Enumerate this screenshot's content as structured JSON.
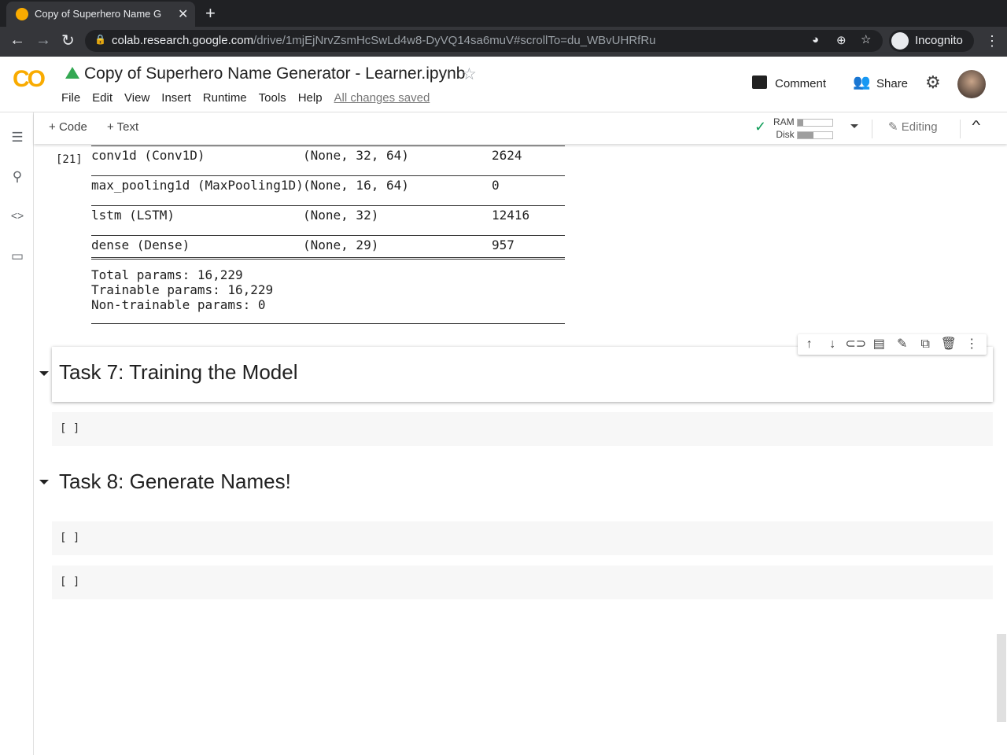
{
  "browser": {
    "tab_title": "Copy of Superhero Name G",
    "url_host": "colab.research.google.com",
    "url_path": "/drive/1mjEjNrvZsmHcSwLd4w8-DyVQ14sa6muV#scrollTo=du_WBvUHRfRu",
    "profile": "Incognito"
  },
  "header": {
    "title": "Copy of Superhero Name Generator - Learner.ipynb",
    "menu": [
      "File",
      "Edit",
      "View",
      "Insert",
      "Runtime",
      "Tools",
      "Help"
    ],
    "save_status": "All changes saved",
    "comment": "Comment",
    "share": "Share"
  },
  "toolbar": {
    "add_code": "Code",
    "add_text": "Text",
    "ram": "RAM",
    "disk": "Disk",
    "ram_usage": 0.15,
    "disk_usage": 0.45,
    "editing": "Editing"
  },
  "output": {
    "exec_count": "[21]",
    "layers": [
      {
        "name": "conv1d (Conv1D)",
        "shape": "(None, 32, 64)",
        "params": "2624"
      },
      {
        "name": "max_pooling1d (MaxPooling1D)",
        "shape": "(None, 16, 64)",
        "params": "0"
      },
      {
        "name": "lstm (LSTM)",
        "shape": "(None, 32)",
        "params": "12416"
      },
      {
        "name": "dense (Dense)",
        "shape": "(None, 29)",
        "params": "957"
      }
    ],
    "total": "Total params: 16,229",
    "trainable": "Trainable params: 16,229",
    "non_trainable": "Non-trainable params: 0"
  },
  "sections": [
    {
      "title": "Task 7: Training the Model"
    },
    {
      "title": "Task 8: Generate Names!"
    }
  ],
  "empty_cell": "[ ]"
}
